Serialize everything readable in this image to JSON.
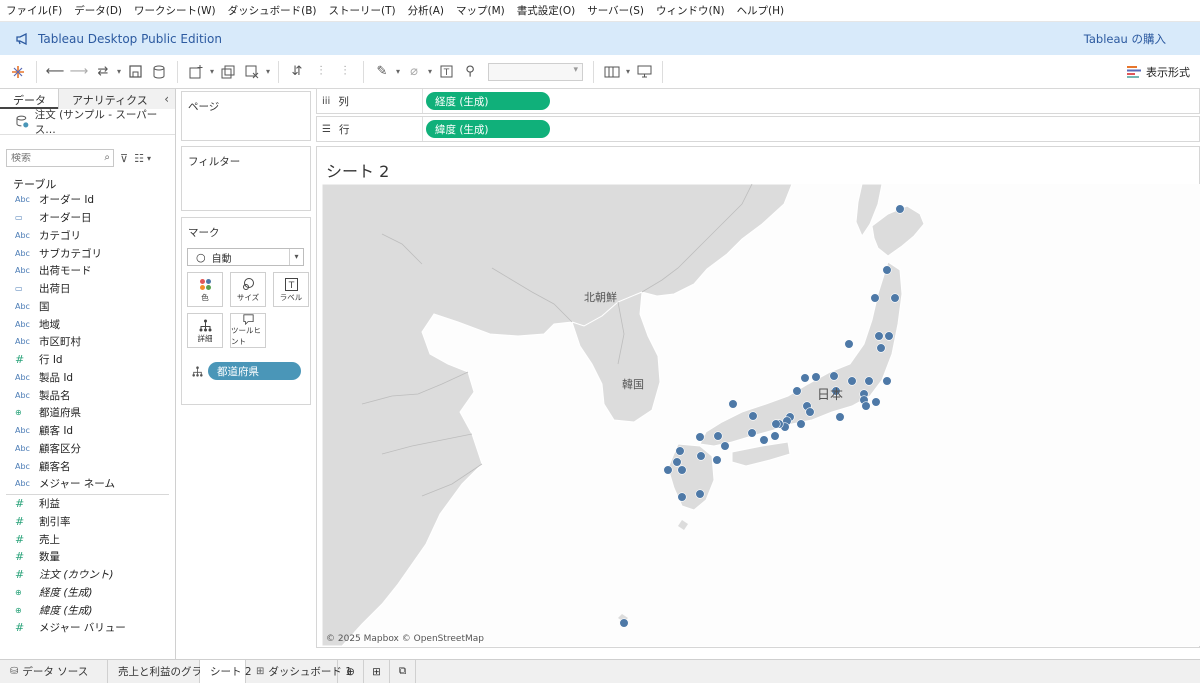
{
  "menu": [
    "ファイル(F)",
    "データ(D)",
    "ワークシート(W)",
    "ダッシュボード(B)",
    "ストーリー(T)",
    "分析(A)",
    "マップ(M)",
    "書式設定(O)",
    "サーバー(S)",
    "ウィンドウ(N)",
    "ヘルプ(H)"
  ],
  "banner": {
    "title": "Tableau Desktop Public Edition",
    "buy": "Tableau の購入"
  },
  "toolbar": {
    "show_me": "表示形式"
  },
  "left": {
    "tabs": [
      "データ",
      "アナリティクス"
    ],
    "datasource": "注文 (サンプル - スーパース…",
    "search_placeholder": "検索",
    "table_title": "テーブル",
    "dimensions": [
      {
        "type": "Abc",
        "name": "オーダー Id"
      },
      {
        "type": "date",
        "name": "オーダー日"
      },
      {
        "type": "Abc",
        "name": "カテゴリ"
      },
      {
        "type": "Abc",
        "name": "サブカテゴリ"
      },
      {
        "type": "Abc",
        "name": "出荷モード"
      },
      {
        "type": "date",
        "name": "出荷日"
      },
      {
        "type": "Abc",
        "name": "国"
      },
      {
        "type": "Abc",
        "name": "地域"
      },
      {
        "type": "Abc",
        "name": "市区町村"
      },
      {
        "type": "#",
        "name": "行 Id"
      },
      {
        "type": "Abc",
        "name": "製品 Id"
      },
      {
        "type": "Abc",
        "name": "製品名"
      },
      {
        "type": "geo",
        "name": "都道府県"
      },
      {
        "type": "Abc",
        "name": "顧客 Id"
      },
      {
        "type": "Abc",
        "name": "顧客区分"
      },
      {
        "type": "Abc",
        "name": "顧客名"
      },
      {
        "type": "Abc",
        "name": "メジャー ネーム"
      }
    ],
    "measures": [
      {
        "type": "#",
        "name": "利益"
      },
      {
        "type": "#",
        "name": "割引率"
      },
      {
        "type": "#",
        "name": "売上"
      },
      {
        "type": "#",
        "name": "数量"
      },
      {
        "type": "#",
        "name": "注文 (カウント)"
      },
      {
        "type": "geo",
        "name": "経度 (生成)"
      },
      {
        "type": "geo",
        "name": "緯度 (生成)"
      },
      {
        "type": "#",
        "name": "メジャー バリュー"
      }
    ]
  },
  "cards": {
    "pages": "ページ",
    "filters": "フィルター",
    "marks": "マーク",
    "mark_type": "自動",
    "buttons": [
      "色",
      "サイズ",
      "ラベル",
      "詳細",
      "ツールヒント"
    ],
    "detail_pill": "都道府県"
  },
  "shelves": {
    "columns_label": "列",
    "columns_pill": "経度 (生成)",
    "rows_label": "行",
    "rows_pill": "緯度 (生成)"
  },
  "sheet": {
    "title": "シート 2",
    "map_labels": [
      "北朝鮮",
      "韓国",
      "日本"
    ],
    "copyright": "© 2025 Mapbox © OpenStreetMap",
    "point_color": "#4e79a7"
  },
  "bottom_tabs": [
    "データ ソース",
    "売上と利益のグラフ",
    "シート 2",
    "ダッシュボード 1"
  ]
}
